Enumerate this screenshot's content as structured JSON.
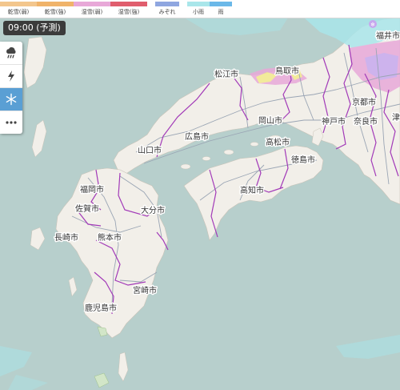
{
  "legend": {
    "items": [
      {
        "label": "乾雪(弱)",
        "color": "#f3c68d"
      },
      {
        "label": "乾雪(強)",
        "color": "#f0b36a"
      },
      {
        "label": "湿雪(弱)",
        "color": "#e8a8d8"
      },
      {
        "label": "湿雪(強)",
        "color": "#e05d6d"
      },
      {
        "label": "みぞれ",
        "color": "#8fa6e0"
      },
      {
        "label": "小雨",
        "color": "#a9e6ea"
      },
      {
        "label": "雨",
        "color": "#6bb8e8"
      }
    ]
  },
  "time_label": "09:00 (予測)",
  "controls": [
    {
      "name": "rain-cloud-icon",
      "glyph": "☁"
    },
    {
      "name": "lightning-icon",
      "glyph": "⚡"
    },
    {
      "name": "snowflake-icon",
      "glyph": "❄",
      "active": true
    },
    {
      "name": "more-icon",
      "glyph": "•••"
    }
  ],
  "cities": {
    "fukui": "福井市",
    "matsue": "松江市",
    "tottori": "鳥取市",
    "kyoto": "京都市",
    "okayama": "岡山市",
    "kobe": "神戸市",
    "nara": "奈良市",
    "tsu": "津",
    "hiroshima": "広島市",
    "yamaguchi": "山口市",
    "takamatsu": "高松市",
    "tokushima": "徳島市",
    "fukuoka": "福岡市",
    "kochi": "高知市",
    "saga": "佐賀市",
    "oita": "大分市",
    "nagasaki": "長崎市",
    "kumamoto": "熊本市",
    "miyazaki": "宮崎市",
    "kagoshima": "鹿児島市"
  },
  "colors": {
    "sea": "#b7cfcc",
    "land": "#f2efe9",
    "boundary": "#a23ab8",
    "road": "#9aa5b4"
  }
}
